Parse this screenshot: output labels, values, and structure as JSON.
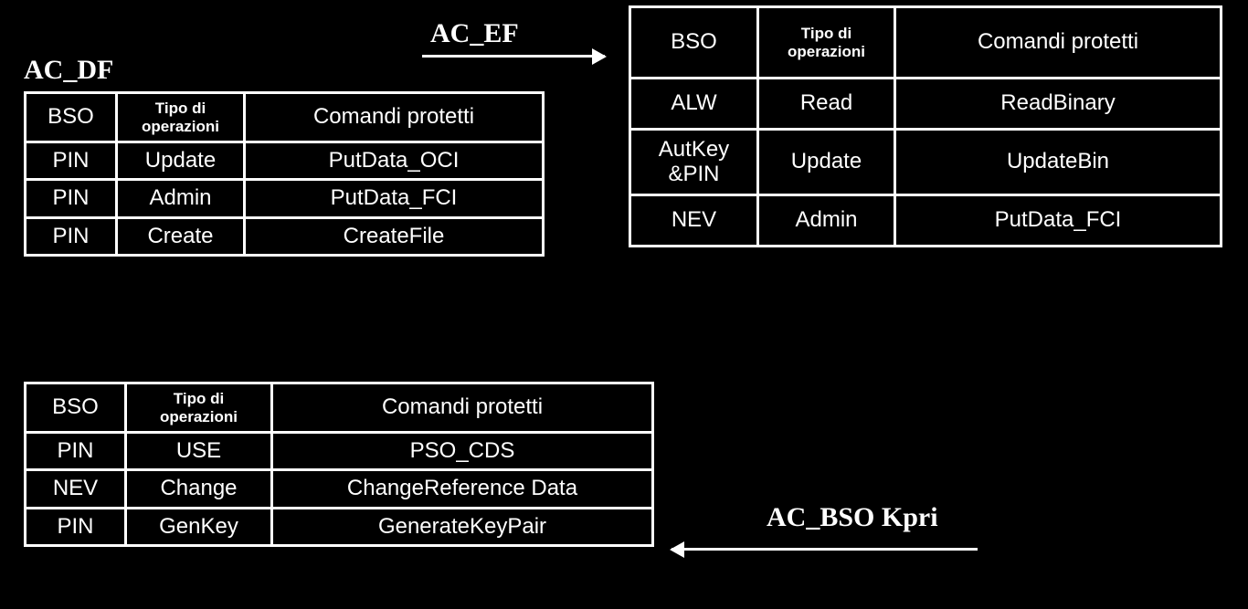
{
  "labels": {
    "ac_df": "AC_DF",
    "ac_ef": "AC_EF",
    "ac_bso_kpri": "AC_BSO Kpri"
  },
  "headers": {
    "bso": "BSO",
    "tipo": "Tipo di operazioni",
    "comandi": "Comandi protetti"
  },
  "table_df": {
    "rows": [
      {
        "bso": "PIN",
        "tipo": "Update",
        "cmd": "PutData_OCI"
      },
      {
        "bso": "PIN",
        "tipo": "Admin",
        "cmd": "PutData_FCI"
      },
      {
        "bso": "PIN",
        "tipo": "Create",
        "cmd": "CreateFile"
      }
    ]
  },
  "table_ef": {
    "rows": [
      {
        "bso": "ALW",
        "tipo": "Read",
        "cmd": "ReadBinary"
      },
      {
        "bso": "AutKey &PIN",
        "tipo": "Update",
        "cmd": "UpdateBin"
      },
      {
        "bso": "NEV",
        "tipo": "Admin",
        "cmd": "PutData_FCI"
      }
    ]
  },
  "table_bso": {
    "rows": [
      {
        "bso": "PIN",
        "tipo": "USE",
        "cmd": "PSO_CDS"
      },
      {
        "bso": "NEV",
        "tipo": "Change",
        "cmd": "ChangeReference Data"
      },
      {
        "bso": "PIN",
        "tipo": "GenKey",
        "cmd": "GenerateKeyPair"
      }
    ]
  }
}
